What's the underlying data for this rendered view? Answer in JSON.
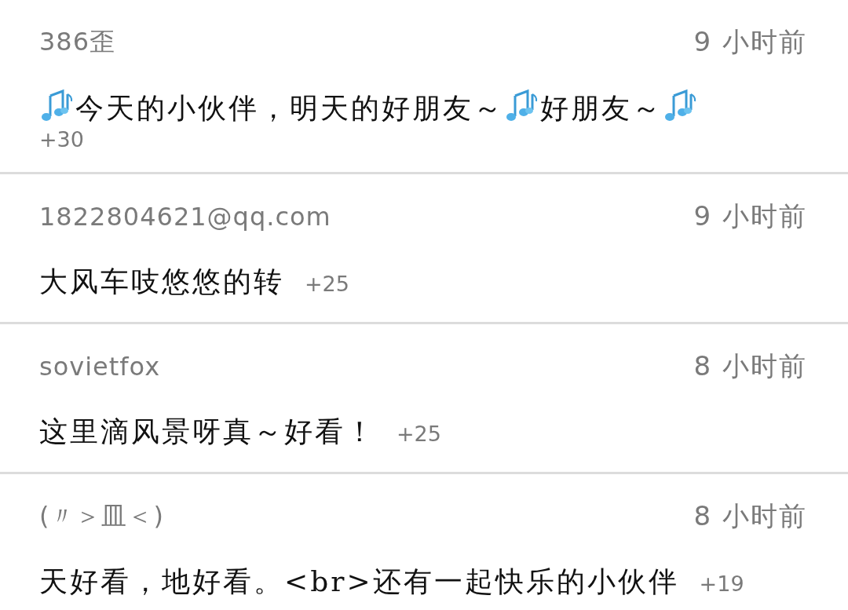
{
  "comments": [
    {
      "username": "386歪",
      "time": "9 小时前",
      "message": [
        {
          "kind": "icon"
        },
        {
          "kind": "text",
          "text": "今天的小伙伴，明天的好朋友～"
        },
        {
          "kind": "icon"
        },
        {
          "kind": "text",
          "text": "好朋友～"
        },
        {
          "kind": "icon"
        }
      ],
      "likes": "+30"
    },
    {
      "username": "1822804621@qq.com",
      "time": "9 小时前",
      "message": [
        {
          "kind": "text",
          "text": "大风车吱悠悠的转"
        }
      ],
      "likes": "+25"
    },
    {
      "username": "sovietfox",
      "time": "8 小时前",
      "message": [
        {
          "kind": "text",
          "text": "这里滴风景呀真～好看！"
        }
      ],
      "likes": "+25"
    },
    {
      "username": "(〃＞皿＜)",
      "time": "8 小时前",
      "message": [
        {
          "kind": "text",
          "text": "天好看，地好看。<br>还有一起快乐的小伙伴"
        }
      ],
      "likes": "+19"
    }
  ]
}
